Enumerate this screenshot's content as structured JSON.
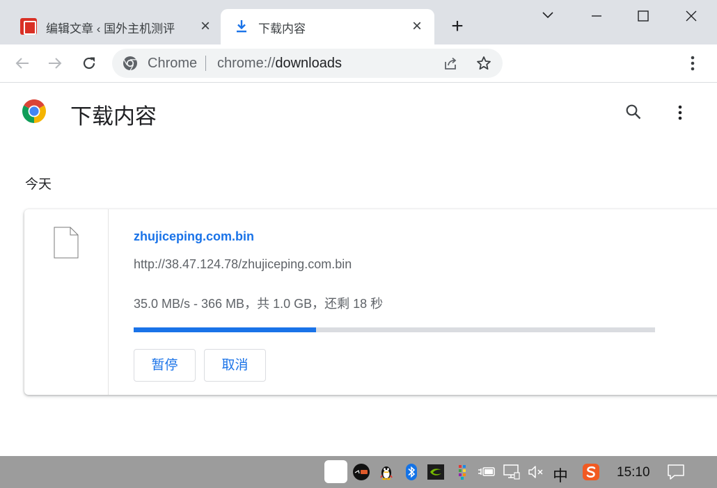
{
  "browser": {
    "tabs": [
      {
        "title": "编辑文章 ‹ 国外主机测评",
        "close": "×",
        "active": false
      },
      {
        "title": "下载内容",
        "close": "×",
        "active": true
      }
    ],
    "new_tab": "+",
    "omnibox": {
      "site_label": "Chrome",
      "url_prefix": "chrome://",
      "url_host": "downloads"
    }
  },
  "downloads_page": {
    "title": "下载内容",
    "section": "今天",
    "item": {
      "file_name": "zhujiceping.com.bin",
      "url": "http://38.47.124.78/zhujiceping.com.bin",
      "status": "35.0 MB/s - 366 MB，共 1.0 GB，还剩 18 秒",
      "progress": 0.35,
      "pause_label": "暂停",
      "cancel_label": "取消"
    }
  },
  "taskbar": {
    "ime": "中",
    "clock": "15:10"
  },
  "colors": {
    "accent": "#1a73e8",
    "tabstrip": "#dee1e6",
    "taskbar": "#9c9c9c"
  }
}
